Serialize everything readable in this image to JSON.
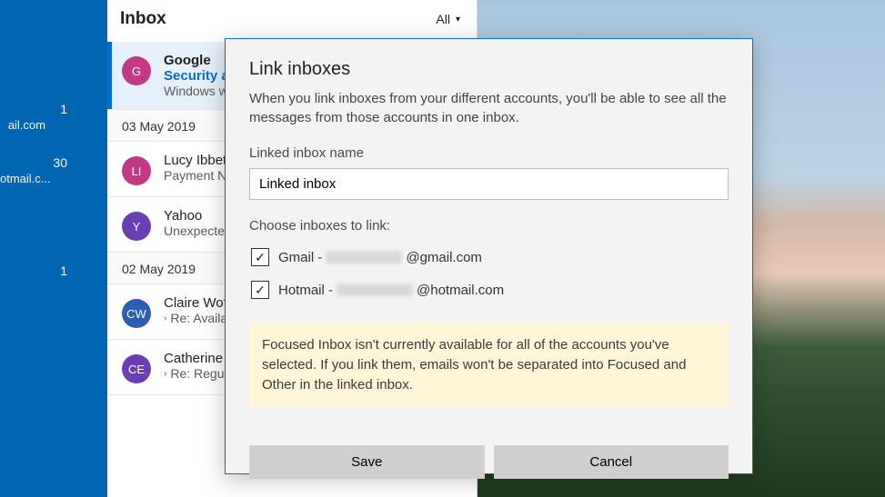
{
  "sidebar": {
    "accounts": [
      {
        "count": "1",
        "label": "ail.com"
      },
      {
        "count": "30",
        "label": "otmail.c..."
      },
      {
        "count": "1",
        "label": ""
      }
    ]
  },
  "inbox": {
    "title": "Inbox",
    "filter": "All",
    "groups": [
      {
        "messages": [
          {
            "sender": "Google",
            "subject": "Security alert",
            "preview": "Windows was used to sign in",
            "avatar_letter": "G",
            "avatar_color": "#c03a85",
            "active": true
          }
        ]
      },
      {
        "date": "03 May 2019",
        "messages": [
          {
            "sender": "Lucy Ibbetson",
            "subject": "Payment Notification",
            "avatar_letter": "LI",
            "avatar_color": "#c03a85"
          },
          {
            "sender": "Yahoo",
            "subject": "Unexpected sign-in attempt",
            "avatar_letter": "Y",
            "avatar_color": "#6a3eb5"
          }
        ]
      },
      {
        "date": "02 May 2019",
        "messages": [
          {
            "sender": "Claire Woffenden",
            "subject": "Re: Available times",
            "avatar_letter": "CW",
            "avatar_color": "#2d5db5",
            "reply": true
          },
          {
            "sender": "Catherine Ellis",
            "subject": "Re: Regular update",
            "avatar_letter": "CE",
            "avatar_color": "#6a3eb5",
            "reply": true
          }
        ]
      }
    ]
  },
  "dialog": {
    "title": "Link inboxes",
    "description": "When you link inboxes from your different accounts, you'll be able to see all the messages from those accounts in one inbox.",
    "name_label": "Linked inbox name",
    "name_value": "Linked inbox",
    "choose_label": "Choose inboxes to link:",
    "options": [
      {
        "prefix": "Gmail - ",
        "suffix": "@gmail.com",
        "checked": true
      },
      {
        "prefix": "Hotmail - ",
        "suffix": "@hotmail.com",
        "checked": true
      }
    ],
    "warning": "Focused Inbox isn't currently available for all of the accounts you've selected. If you link them, emails won't be separated into Focused and Other in the linked inbox.",
    "save_label": "Save",
    "cancel_label": "Cancel"
  }
}
